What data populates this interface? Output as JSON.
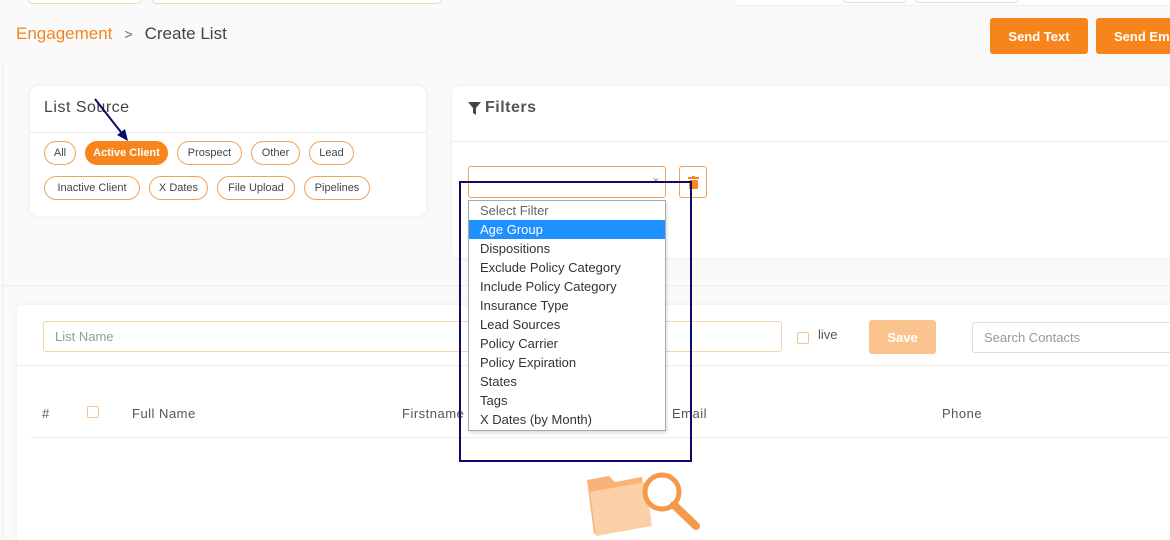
{
  "breadcrumb": {
    "parent": "Engagement",
    "separator": ">",
    "current": "Create List"
  },
  "actions": {
    "send_text": "Send Text",
    "send_email": "Send Em"
  },
  "list_source": {
    "title": "List Source",
    "chips": [
      {
        "label": "All",
        "active": false
      },
      {
        "label": "Active Client",
        "active": true
      },
      {
        "label": "Prospect",
        "active": false
      },
      {
        "label": "Other",
        "active": false
      },
      {
        "label": "Lead",
        "active": false
      },
      {
        "label": "Inactive Client",
        "active": false
      },
      {
        "label": "X Dates",
        "active": false
      },
      {
        "label": "File Upload",
        "active": false
      },
      {
        "label": "Pipelines",
        "active": false
      }
    ]
  },
  "filters": {
    "title": "Filters",
    "icon": "filter-icon",
    "clear_symbol": "×",
    "dropdown": {
      "placeholder": "Select Filter",
      "selected": "Age Group",
      "options": [
        "Age Group",
        "Dispositions",
        "Exclude Policy Category",
        "Include Policy Category",
        "Insurance Type",
        "Lead Sources",
        "Policy Carrier",
        "Policy Expiration",
        "States",
        "Tags",
        "X Dates (by Month)"
      ]
    }
  },
  "list_form": {
    "list_name_placeholder": "List Name",
    "live_label": "live",
    "save_label": "Save",
    "search_placeholder": "Search Contacts"
  },
  "table": {
    "headers": {
      "index": "#",
      "full_name": "Full Name",
      "firstname": "Firstname",
      "email": "Email",
      "phone": "Phone"
    }
  },
  "colors": {
    "accent": "#f7851c",
    "accent_light": "#fbc38d",
    "selected_option": "#1e90ff",
    "annotation": "#0b0b6e"
  }
}
